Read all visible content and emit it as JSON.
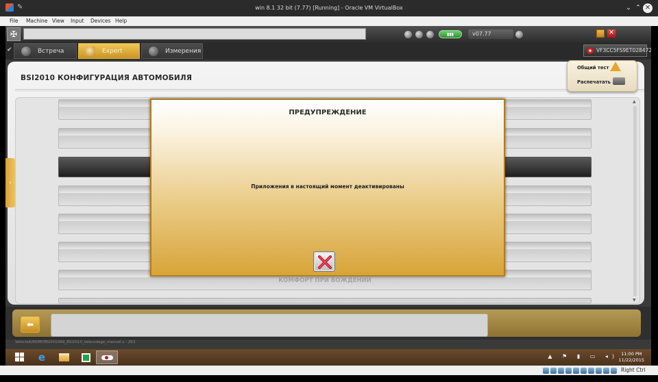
{
  "vbox": {
    "title": "win 8.1 32 bit (7.77) [Running] - Oracle VM VirtualBox",
    "menu": [
      "File",
      "Machine",
      "View",
      "Input",
      "Devices",
      "Help"
    ],
    "host_key": "Right Ctrl"
  },
  "diagbox": {
    "version": "v07.77",
    "tabs": [
      {
        "label": "Встреча",
        "active": false
      },
      {
        "label": "Expert",
        "active": true
      },
      {
        "label": "Измерения",
        "active": false
      }
    ],
    "vin": "VF3CC5FS9ET028472",
    "page_title": "BSI2010  КОНФИГУРАЦИЯ АВТОМОБИЛЯ",
    "list_rows": [
      {
        "label": "",
        "selected": false
      },
      {
        "label": "",
        "selected": false
      },
      {
        "label": "",
        "selected": true
      },
      {
        "label": "",
        "selected": false
      },
      {
        "label": "",
        "selected": false
      },
      {
        "label": "",
        "selected": false
      },
      {
        "label": "КОМФОРТ ПРИ ВОЖДЕНИИ",
        "selected": false
      },
      {
        "label": "",
        "selected": false
      }
    ],
    "side_menu": {
      "test_label": "Общий тест",
      "print_label": "Распечатать"
    },
    "path": "VehicleA/BSMP/BSI2010A9_BSI2010_telecodage_manuel.s - 263"
  },
  "dialog": {
    "title": "ПРЕДУПРЕЖДЕНИЕ",
    "message": "Приложения в настоящий момент деактивированы"
  },
  "taskbar": {
    "time": "11:00 PM",
    "date": "11/22/2015"
  },
  "colors": {
    "accent": "#e3ad3c",
    "dialog_border": "#b07c20",
    "close_x": "#c4122f"
  }
}
